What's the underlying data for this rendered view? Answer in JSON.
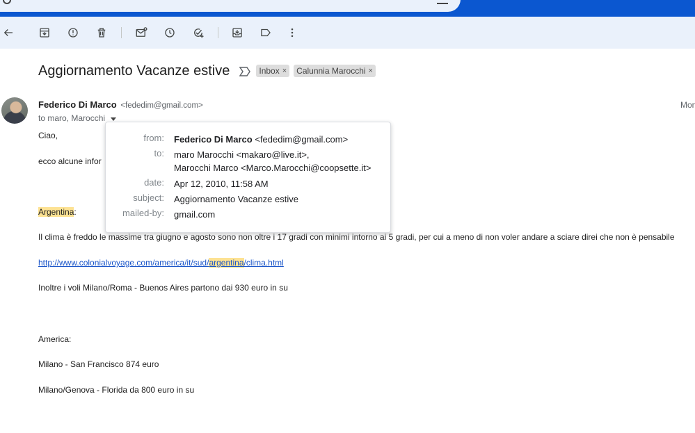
{
  "toolbar": {
    "buttons": [
      "back",
      "archive",
      "report-spam",
      "delete",
      "mark-unread",
      "snooze",
      "add-to-tasks",
      "move-to",
      "labels",
      "more"
    ]
  },
  "message": {
    "subject": "Aggiornamento Vacanze estive",
    "labels": [
      "Inbox",
      "Calunnia Marocchi"
    ],
    "sender_name": "Federico Di Marco",
    "sender_email": "<fededim@gmail.com>",
    "date_short": "Mon",
    "to_line": "to maro, Marocchi"
  },
  "details": {
    "from_key": "from:",
    "from_name": "Federico Di Marco",
    "from_email": "<fededim@gmail.com>",
    "to_key": "to:",
    "to_1": "maro Marocchi <makaro@live.it>,",
    "to_2": "Marocchi Marco <Marco.Marocchi@coopsette.it>",
    "date_key": "date:",
    "date_val": "Apr 12, 2010, 11:58 AM",
    "subject_key": "subject:",
    "subject_val": "Aggiornamento Vacanze estive",
    "mailedby_key": "mailed-by:",
    "mailedby_val": "gmail.com"
  },
  "body": {
    "greeting": "Ciao,",
    "intro": "ecco alcune infor",
    "country": "Argentina",
    "country_suffix": ":",
    "climate": "Il clima è freddo le massime tra giugno e agosto sono non oltre i 17 gradi con minimi intorno ai 5 gradi, per cui a  meno di non voler andare a sciare direi che non è pensabile",
    "link_pre": "http://www.colonialvoyage.com/america/it/sud/",
    "link_hl": "argentina",
    "link_post": "/clima.html",
    "flights": "Inoltre i voli Milano/Roma  - Buenos Aires partono dai 930 euro in su",
    "america": "America:",
    "sf": "Milano - San Francisco 874 euro",
    "florida": "Milano/Genova - Florida da 800 euro in su"
  }
}
